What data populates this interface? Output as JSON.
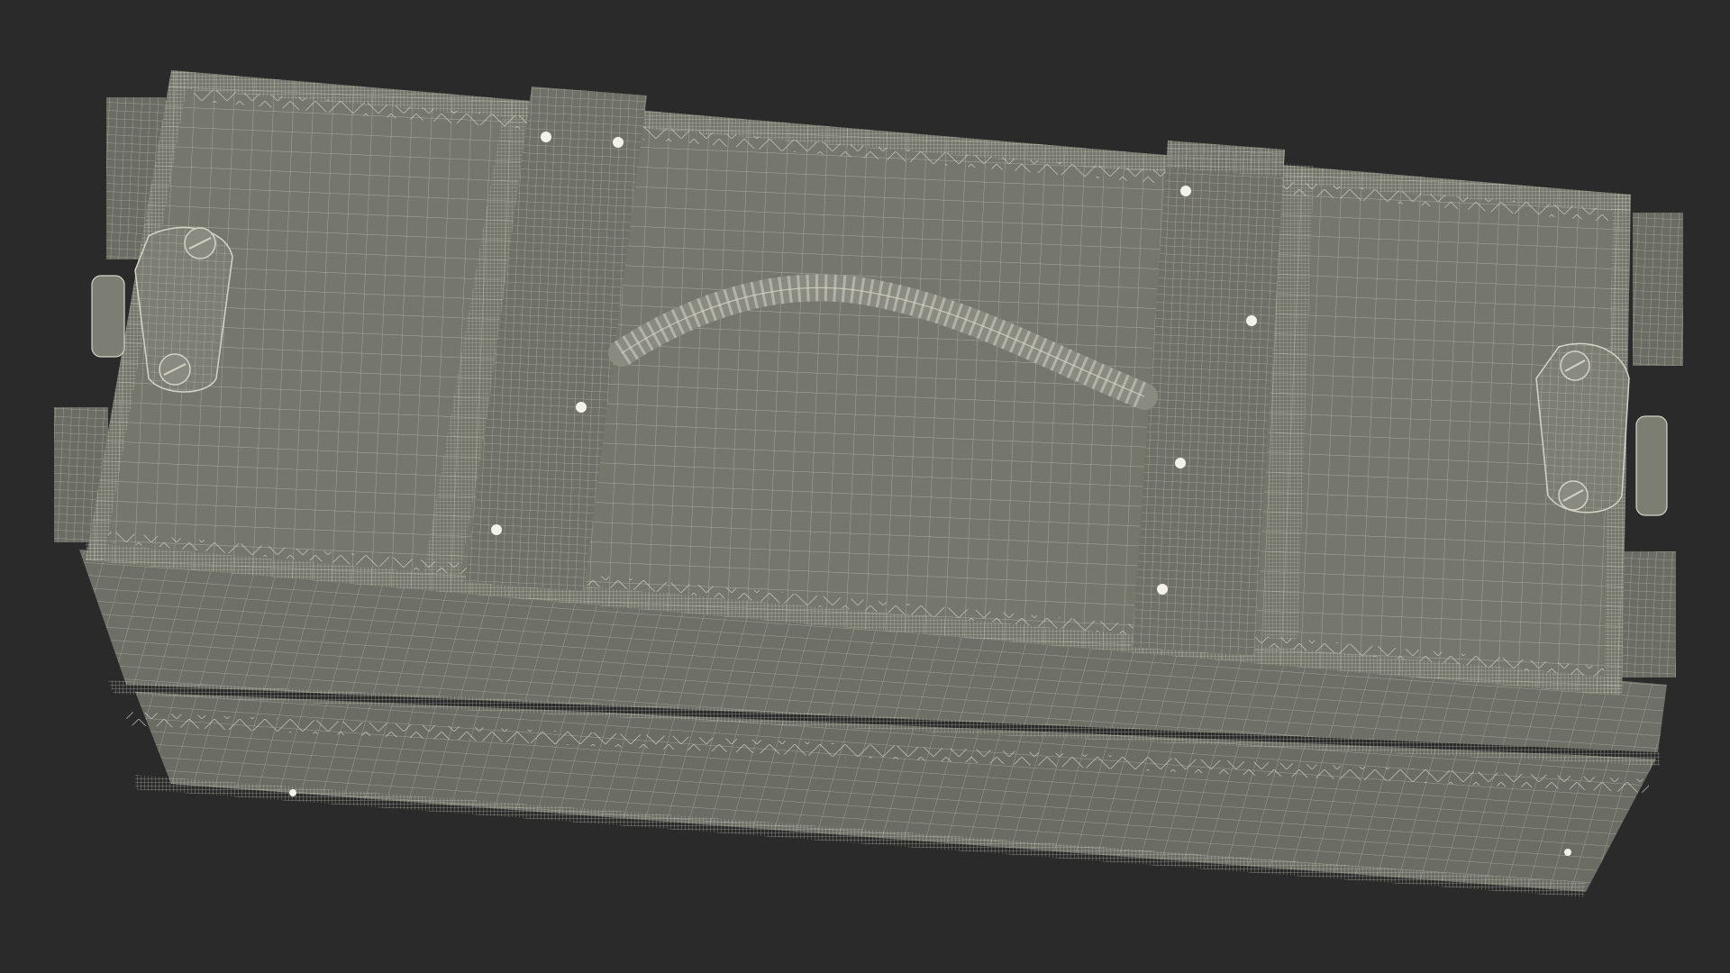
{
  "scene": {
    "subject": "wireframe-wooden-crate",
    "background_color": "#2a2a2a",
    "surface_color": "#75766c",
    "surface_dark_color": "#5f6058",
    "wire_color": "#d4d4c6",
    "wire_dense_color": "#bfc0b2",
    "rivet_color": "#f2f2ea"
  }
}
